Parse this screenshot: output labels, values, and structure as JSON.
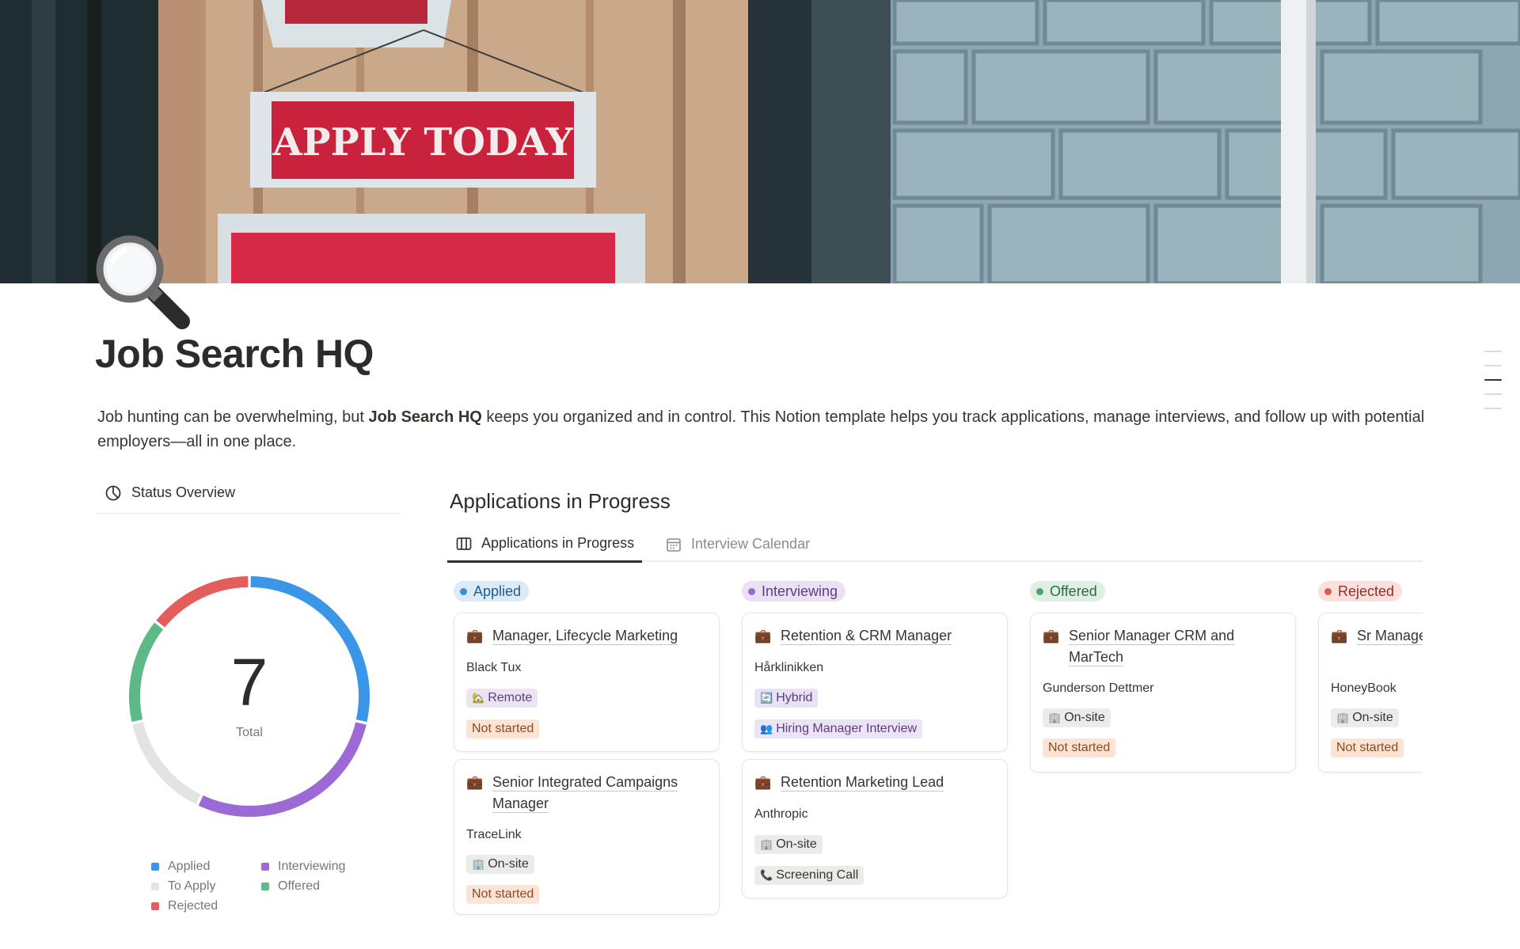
{
  "page": {
    "title": "Job Search HQ",
    "icon": "magnifying-glass-icon",
    "intro_before": "Job hunting can be overwhelming, but ",
    "intro_bold": "Job Search HQ",
    "intro_after": " keeps you organized and in control. This Notion template helps you track applications, manage interviews, and follow up with potential employers—all in one place.",
    "cover": {
      "sign_text": "APPLY TODAY"
    }
  },
  "status_overview": {
    "tab_label": "Status Overview",
    "total_value": "7",
    "total_label": "Total",
    "legend": [
      {
        "label": "Applied",
        "color": "#3a96e6"
      },
      {
        "label": "Interviewing",
        "color": "#9c6ad4"
      },
      {
        "label": "To Apply",
        "color": "#e3e3e1"
      },
      {
        "label": "Offered",
        "color": "#5dba86"
      },
      {
        "label": "Rejected",
        "color": "#e35d5b"
      }
    ],
    "chart_data": {
      "type": "pie",
      "categories": [
        "Applied",
        "Interviewing",
        "To Apply",
        "Offered",
        "Rejected"
      ],
      "values": [
        2,
        2,
        1,
        1,
        1
      ],
      "colors": [
        "#3a96e6",
        "#9c6ad4",
        "#e3e3e1",
        "#5dba86",
        "#e35d5b"
      ],
      "total": 7,
      "legend_position": "bottom"
    }
  },
  "board": {
    "title": "Applications in Progress",
    "views": [
      {
        "label": "Applications in Progress",
        "icon": "board-icon",
        "active": true
      },
      {
        "label": "Interview Calendar",
        "icon": "calendar-icon",
        "active": false
      }
    ],
    "columns": [
      {
        "name": "Applied",
        "bg": "#dcebf7",
        "dot": "#3a8fd6",
        "text": "#1e5d8f",
        "cards": [
          {
            "title": "Manager, Lifecycle Marketing",
            "company": "Black Tux",
            "work_mode": "Remote",
            "work_mode_icon": "house-icon",
            "stage": "Not started"
          },
          {
            "title": "Senior Integrated Campaigns Manager",
            "company": "TraceLink",
            "work_mode": "On-site",
            "work_mode_icon": "office-building-icon",
            "stage": "Not started"
          }
        ]
      },
      {
        "name": "Interviewing",
        "bg": "#ebe1f5",
        "dot": "#9a6ad1",
        "text": "#5d3d82",
        "cards": [
          {
            "title": "Retention & CRM Manager",
            "company": "Hårklinikken",
            "work_mode": "Hybrid",
            "work_mode_icon": "refresh-icon",
            "stage": "Hiring Manager Interview",
            "stage_icon": "people-icon"
          },
          {
            "title": "Retention Marketing Lead",
            "company": "Anthropic",
            "work_mode": "On-site",
            "work_mode_icon": "office-building-icon",
            "stage": "Screening Call",
            "stage_icon": "phone-icon"
          }
        ]
      },
      {
        "name": "Offered",
        "bg": "#dfefe4",
        "dot": "#4aa56e",
        "text": "#2b6b43",
        "cards": [
          {
            "title": "Senior Manager CRM and MarTech",
            "company": "Gunderson Dettmer",
            "work_mode": "On-site",
            "work_mode_icon": "office-building-icon",
            "stage": "Not started"
          }
        ]
      },
      {
        "name": "Rejected",
        "bg": "#fbe0dd",
        "dot": "#de5b52",
        "text": "#8f2f29",
        "cards": [
          {
            "title": "Sr Manager, Marketing",
            "company": "HoneyBook",
            "work_mode": "On-site",
            "work_mode_icon": "office-building-icon",
            "stage": "Not started"
          }
        ]
      }
    ]
  }
}
